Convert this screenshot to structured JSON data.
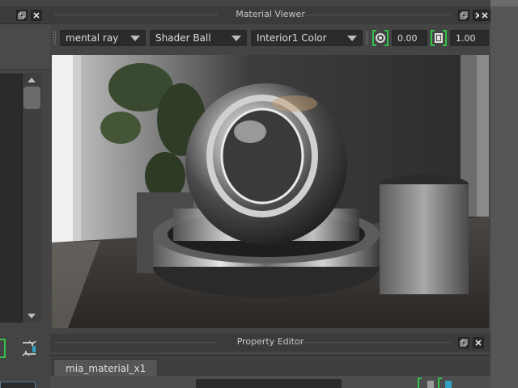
{
  "viewer": {
    "title": "Material Viewer",
    "renderer": "mental ray",
    "geometry": "Shader Ball",
    "environment": "Interior1 Color",
    "exposure_value": "0.00",
    "gamma_value": "1.00"
  },
  "property_editor": {
    "title": "Property Editor",
    "tab_label": "mia_material_x1"
  },
  "icons": {
    "float": "float-window-icon",
    "close": "close-icon",
    "exposure": "exposure-icon",
    "gamma": "gamma-icon",
    "swap": "swap-icon"
  },
  "colors": {
    "panel_bg": "#444444",
    "titlebar_bg": "#3b3b3b",
    "field_bg": "#2b2b2b",
    "accent_green": "#34c24a",
    "accent_blue": "#5a7a9a"
  }
}
